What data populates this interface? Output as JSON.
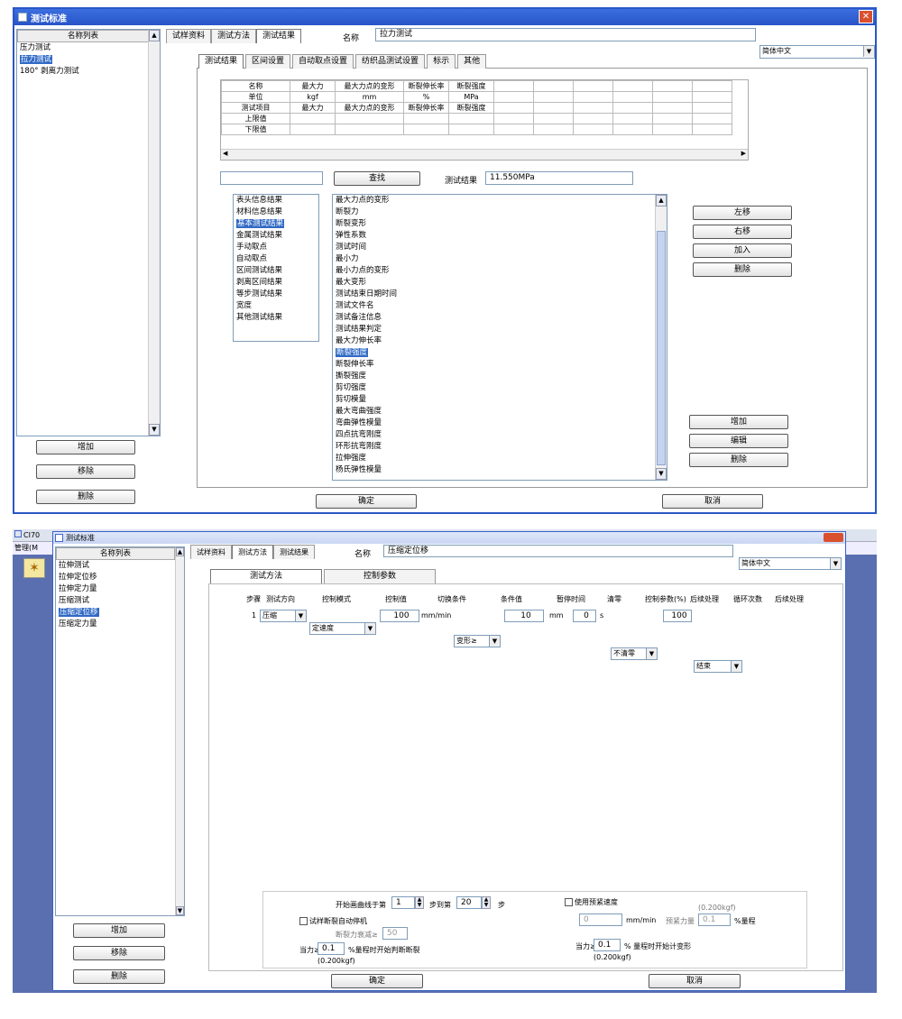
{
  "top": {
    "window_title": "测试标准",
    "close_glyph": "✕",
    "left_header": "名称列表",
    "left_items": [
      "压力测试",
      "拉力测试",
      "180° 剥离力测试"
    ],
    "left_selected": 1,
    "left_buttons": {
      "add": "增加",
      "remove": "移除",
      "delete": "删除"
    },
    "main_tabs": [
      "试样资料",
      "测试方法",
      "测试结果"
    ],
    "main_tab_active": 2,
    "name_label": "名称",
    "name_value": "拉力测试",
    "language": "简体中文",
    "sub_tabs": [
      "测试结果",
      "区间设置",
      "自动取点设置",
      "纺织品测试设置",
      "标示",
      "其他"
    ],
    "sub_tab_active": 0,
    "grid_rows": [
      {
        "label": "名称",
        "cells": [
          "最大力",
          "最大力点的变形",
          "断裂伸长率",
          "断裂强度"
        ]
      },
      {
        "label": "单位",
        "cells": [
          "kgf",
          "mm",
          "%",
          "MPa"
        ]
      },
      {
        "label": "测试项目",
        "cells": [
          "最大力",
          "最大力点的变形",
          "断裂伸长率",
          "断裂强度"
        ]
      },
      {
        "label": "上限值",
        "cells": [
          "",
          "",
          "",
          ""
        ]
      },
      {
        "label": "下限值",
        "cells": [
          "",
          "",
          "",
          ""
        ]
      }
    ],
    "find_button": "查找",
    "result_label": "测试结果",
    "result_value": "11.550MPa",
    "categories": [
      "表头信息结果",
      "材料信息结果",
      "基本测试结果",
      "金属测试结果",
      "手动取点",
      "自动取点",
      "区间测试结果",
      "剥离区间结果",
      "等步测试结果",
      "宽度",
      "其他测试结果"
    ],
    "categories_selected": 2,
    "items": [
      "最大力点的变形",
      "断裂力",
      "断裂变形",
      "弹性系数",
      "测试时间",
      "最小力",
      "最小力点的变形",
      "最大变形",
      "测试结束日期时间",
      "测试文件名",
      "测试备注信息",
      "测试结果判定",
      "最大力伸长率",
      "断裂强度",
      "断裂伸长率",
      "撕裂强度",
      "剪切强度",
      "剪切模量",
      "最大弯曲强度",
      "弯曲弹性模量",
      "四点抗弯刚度",
      "环形抗弯刚度",
      "拉伸强度",
      "杨氏弹性模量"
    ],
    "items_selected": 13,
    "right_buttons1": [
      "左移",
      "右移",
      "加入",
      "删除"
    ],
    "right_buttons2": [
      "增加",
      "编辑",
      "删除"
    ],
    "ok": "确定",
    "cancel": "取消"
  },
  "bottom": {
    "app_tab_fragment": "CI70",
    "window_title": "测试标准",
    "menu_fragment": "管理(M",
    "left_header": "名称列表",
    "left_items": [
      "拉伸测试",
      "拉伸定位移",
      "拉伸定力量",
      "压缩测试",
      "压缩定位移",
      "压缩定力量"
    ],
    "left_selected": 4,
    "left_buttons": {
      "add": "增加",
      "remove": "移除",
      "delete": "删除"
    },
    "main_tabs": [
      "试样资料",
      "测试方法",
      "测试结果"
    ],
    "main_tab_active": 1,
    "name_label": "名称",
    "name_value": "压缩定位移",
    "language": "简体中文",
    "sub_tabs": [
      "测试方法",
      "控制参数"
    ],
    "sub_tab_active": 0,
    "step_headers": [
      "步骤",
      "测试方向",
      "控制模式",
      "控制值",
      "切换条件",
      "条件值",
      "暂停时间",
      "清零",
      "控制参数(%)",
      "后续处理",
      "循环次数",
      "后续处理"
    ],
    "step_row": {
      "num": "1",
      "direction": "压缩",
      "mode": "定速度",
      "value": "100",
      "value_unit": "mm/min",
      "switch": "变形≥",
      "cond_value": "10",
      "cond_unit": "mm",
      "pause": "0",
      "pause_unit": "s",
      "zero": "不清零",
      "param": "100",
      "after": "结束"
    },
    "curve_start_label": "开始画曲线于第",
    "curve_start": "1",
    "step_to_label": "步到第",
    "step_to": "20",
    "step_unit": "步",
    "preload_label": "使用预紧速度",
    "preload_note": "(0.200kgf)",
    "preload_speed": "0",
    "preload_unit": "mm/min",
    "preload_force_label": "预紧力量",
    "preload_force": "0.1",
    "preload_force_unit": "%量程",
    "auto_stop_label": "试样断裂自动停机",
    "decay_label": "断裂力衰减≥",
    "decay_value": "50",
    "force_label": "当力≥",
    "force_value": "0.1",
    "force_suffix": "%量程时开始判断断裂",
    "force_note": "(0.200kgf)",
    "force2_label": "当力≥",
    "force2_value": "0.1",
    "force2_suffix": "% 量程时开始计变形",
    "force2_note": "(0.200kgf)",
    "ok": "确定",
    "cancel": "取消"
  }
}
